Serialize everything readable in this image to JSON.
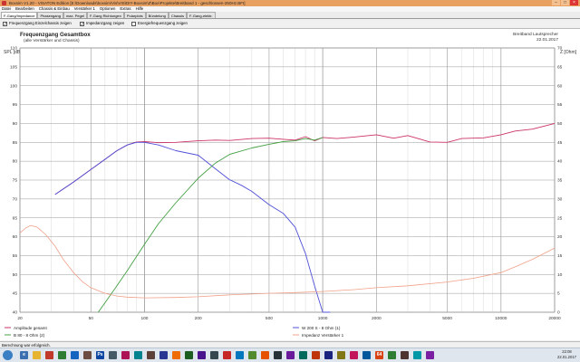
{
  "window": {
    "title": "Boxsim V1.20 - VISATON Edition [E:\\Downloads\\boxsim\\Vis\\VIS\\DIY-Boxsim\\Z\\Box\\Projekte\\Breitband 1 - geschlossen-250Hz.BFI]"
  },
  "menu": [
    "Datei",
    "Bearbeiten",
    "Chassis & Einbau",
    "Verstärker 1",
    "Optionen",
    "Extras",
    "Hilfe"
  ],
  "tabs": [
    "F-Gang/Impedance",
    "Phasengang",
    "max. Pegel",
    "F-Gang Richtungen",
    "Polarplots",
    "Bündelung",
    "Chassis",
    "F-Gang-elektr."
  ],
  "options": {
    "opt1": "Frequenzgang Einzelchassis zeigen",
    "opt2": "Impedanzgang zeigen",
    "opt3": "Energiefrequenzgang zeigen"
  },
  "plot": {
    "title": "Frequenzgang Gesamtbox",
    "subtitle": "(alle Verstärker und Chassis)",
    "right_title": "Breitband Lautsprecher",
    "date": "22.01.2017"
  },
  "legend": {
    "amp": "Amplitude gesamt",
    "w200": "W 200 S - 8 Ohm (1)",
    "b80": "B 80 - 8 Ohm (2)",
    "imp": "Impedanz Verstärker 1"
  },
  "status": "Berechnung war erfolgreich.",
  "clock": {
    "time": "22:08",
    "date": "22.01.2017"
  },
  "chart_data": {
    "type": "line",
    "title": "Frequenzgang Gesamtbox",
    "subtitle": "(alle Verstärker und Chassis)",
    "ylabel": "SPL [dB]",
    "y2label": "Z [Ohm]",
    "xscale": "log",
    "xlim": [
      20,
      20000
    ],
    "ylim": [
      40,
      110
    ],
    "y2lim": [
      0,
      70
    ],
    "x_ticks": [
      20,
      50,
      100,
      200,
      500,
      1000,
      2000,
      5000,
      10000,
      20000
    ],
    "y_ticks": [
      40,
      45,
      50,
      55,
      60,
      65,
      70,
      75,
      80,
      85,
      90,
      95,
      100,
      105,
      110
    ],
    "y2_ticks": [
      0,
      5,
      10,
      15,
      20,
      25,
      30,
      35,
      40,
      45,
      50,
      55,
      60,
      65,
      70
    ],
    "grid": true,
    "legend_position": "bottom",
    "colors": {
      "amp": "#cc3366",
      "w200": "#5050d8",
      "b80": "#44a044",
      "imp": "#f0a088"
    },
    "series": [
      {
        "name": "Amplitude gesamt",
        "axis": "left",
        "x": [
          31.5,
          40,
          50,
          60,
          70,
          80,
          90,
          100,
          120,
          150,
          200,
          250,
          300,
          400,
          500,
          600,
          700,
          800,
          900,
          1000,
          1200,
          1500,
          2000,
          2500,
          3000,
          4000,
          5000,
          6000,
          8000,
          10000,
          12000,
          15000,
          20000
        ],
        "y": [
          71.2,
          74.5,
          77.8,
          80.5,
          82.8,
          84.3,
          85.1,
          85.2,
          84.9,
          85.0,
          85.4,
          85.6,
          85.5,
          86.0,
          86.1,
          85.8,
          85.6,
          86.5,
          85.4,
          86.3,
          86.0,
          86.4,
          87.0,
          86.1,
          86.8,
          85.1,
          85.0,
          86.0,
          86.2,
          87.0,
          88.0,
          88.5,
          90.0
        ]
      },
      {
        "name": "W 200 S - 8 Ohm (1)",
        "axis": "left",
        "x": [
          31.5,
          40,
          50,
          60,
          70,
          80,
          90,
          100,
          120,
          150,
          200,
          250,
          300,
          350,
          400,
          500,
          600,
          700,
          800,
          900,
          1000,
          1100
        ],
        "y": [
          71.2,
          74.5,
          77.8,
          80.5,
          82.8,
          84.3,
          85.0,
          85.0,
          84.3,
          82.8,
          81.6,
          78.0,
          75.1,
          73.6,
          72.0,
          68.5,
          66.2,
          62.5,
          55.5,
          47.0,
          40.0,
          40.0
        ]
      },
      {
        "name": "B 80 - 8 Ohm (2)",
        "axis": "left",
        "x": [
          55,
          60,
          70,
          80,
          100,
          120,
          150,
          200,
          250,
          300,
          400,
          500,
          600,
          700,
          800,
          900,
          1000
        ],
        "y": [
          40.0,
          42.5,
          47.0,
          51.0,
          58.0,
          63.5,
          69.0,
          75.5,
          79.5,
          81.8,
          83.5,
          84.5,
          85.2,
          85.4,
          86.0,
          85.6,
          86.3
        ]
      },
      {
        "name": "Impedanz Verstärker 1",
        "axis": "right",
        "x": [
          20,
          21.5,
          23,
          25,
          28,
          31.5,
          35,
          40,
          45,
          50,
          60,
          70,
          80,
          100,
          150,
          200,
          300,
          500,
          700,
          1000,
          1500,
          2000,
          3000,
          5000,
          7000,
          10000,
          12000,
          15000,
          20000
        ],
        "y": [
          21.0,
          22.3,
          23.0,
          22.5,
          20.5,
          17.5,
          14.0,
          10.5,
          8.0,
          6.5,
          5.0,
          4.3,
          4.0,
          3.8,
          3.9,
          4.1,
          4.6,
          5.0,
          5.2,
          5.5,
          6.0,
          6.5,
          7.0,
          8.0,
          9.0,
          10.5,
          12.0,
          14.0,
          17.0
        ]
      }
    ]
  }
}
